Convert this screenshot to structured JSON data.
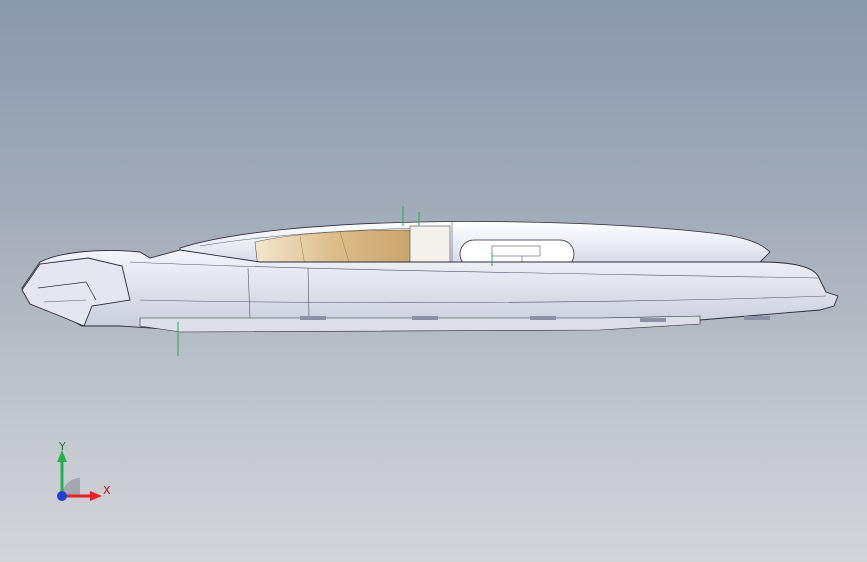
{
  "viewport": {
    "background_top": "#8a98ab",
    "background_bottom": "#d2d4d8"
  },
  "triad": {
    "x_label": "X",
    "y_label": "Y",
    "x_color": "#e8212a",
    "y_color": "#22b14c",
    "z_color": "#1f3fd6"
  },
  "model": {
    "body_color": "#eef0f8",
    "edge_color": "#2b2b3a",
    "interior_color": "#e2c9a0",
    "origin_marker_color": "#22b14c"
  }
}
